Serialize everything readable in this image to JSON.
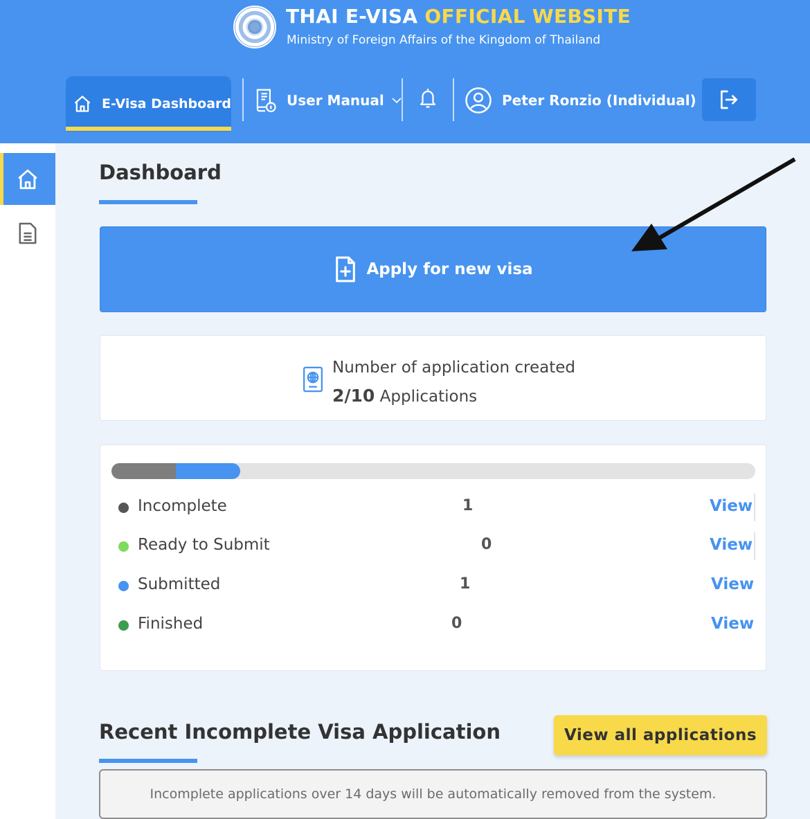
{
  "header": {
    "title_main": "THAI E-VISA",
    "title_accent": "OFFICIAL WEBSITE",
    "subtitle": "Ministry of Foreign Affairs of the Kingdom of Thailand"
  },
  "nav": {
    "dashboard_label": "E-Visa Dashboard",
    "user_manual_label": "User Manual",
    "user_label": "Peter Ronzio (Individual)"
  },
  "icons": {
    "seal": "thai-government-seal",
    "dashboard": "home-icon",
    "manual": "book-info-icon",
    "bell": "bell-icon",
    "user": "user-circle-icon",
    "logout": "logout-icon",
    "sidebar_home": "home-icon",
    "sidebar_docs": "document-icon",
    "apply": "file-plus-icon",
    "count": "passport-icon"
  },
  "colors": {
    "primary": "#4793ef",
    "primary_dark": "#2f80e4",
    "accent_yellow": "#f7d94a",
    "incomplete": "#555555",
    "ready": "#7ddc5a",
    "submitted": "#4793ef",
    "finished": "#3f9b4f"
  },
  "main": {
    "page_title": "Dashboard",
    "apply_button_label": "Apply for new visa",
    "count_label": "Number of application created",
    "count_value": "2/10",
    "count_unit": "Applications",
    "progress": {
      "incomplete_fraction": 0.1,
      "submitted_fraction": 0.1
    },
    "statuses": [
      {
        "label": "Incomplete",
        "count": "1",
        "view_label": "View"
      },
      {
        "label": "Ready to Submit",
        "count": "0",
        "view_label": "View"
      },
      {
        "label": "Submitted",
        "count": "1",
        "view_label": "View"
      },
      {
        "label": "Finished",
        "count": "0",
        "view_label": "View"
      }
    ],
    "recent_title": "Recent Incomplete Visa Application",
    "view_all_label": "View all applications",
    "notice": "Incomplete applications over 14 days will be automatically removed from the system."
  }
}
